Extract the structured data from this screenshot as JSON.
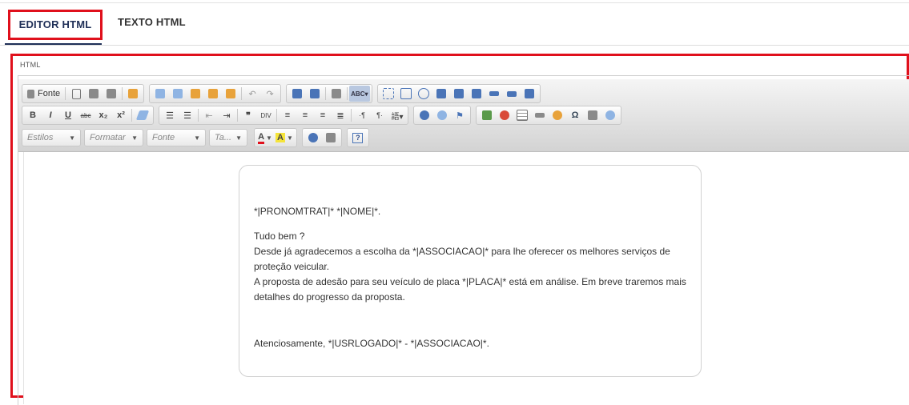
{
  "tabs": {
    "editor_html": "EDITOR HTML",
    "texto_html": "TEXTO HTML"
  },
  "editor_label": "HTML",
  "toolbar": {
    "source_label": "Fonte",
    "styles_placeholder": "Estilos",
    "format_placeholder": "Formatar",
    "font_placeholder": "Fonte",
    "size_placeholder": "Ta...",
    "bold": "B",
    "italic": "I",
    "underline": "U",
    "strike": "abc",
    "subscript": "x₂",
    "superscript": "x²",
    "omega": "Ω",
    "help": "?"
  },
  "content": {
    "greeting": "*|PRONOMTRAT|* *|NOME|*.",
    "line1": "Tudo bem ?",
    "line2": "Desde já agradecemos a escolha da *|ASSOCIACAO|* para lhe oferecer os melhores serviços de proteção veicular.",
    "line3": "A proposta de adesão para seu veículo de placa *|PLACA|* está em análise. Em breve traremos mais detalhes do progresso da proposta.",
    "closing": "Atenciosamente, *|USRLOGADO|* - *|ASSOCIACAO|*."
  },
  "colors": {
    "highlight_border": "#e0101c",
    "active_tab_text": "#1f2f57"
  }
}
